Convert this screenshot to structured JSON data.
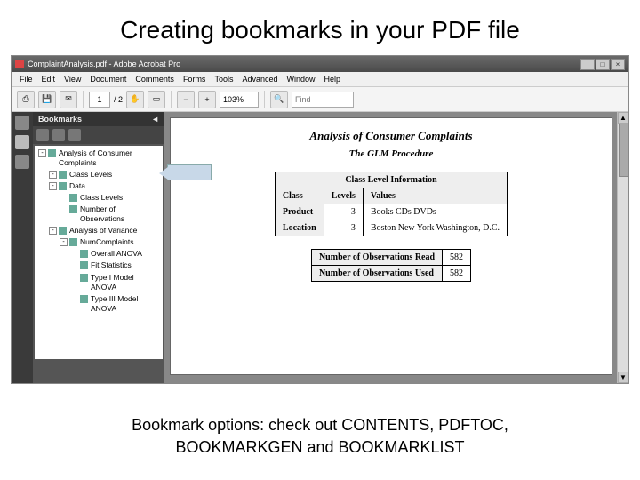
{
  "slide": {
    "title": "Creating bookmarks in your PDF file",
    "footer_line1": "Bookmark options: check out CONTENTS, PDFTOC,",
    "footer_line2": "BOOKMARKGEN and BOOKMARKLIST"
  },
  "window": {
    "title": "ComplaintAnalysis.pdf - Adobe Acrobat Pro",
    "controls": {
      "min": "_",
      "max": "□",
      "close": "×"
    }
  },
  "menu": [
    "File",
    "Edit",
    "View",
    "Document",
    "Comments",
    "Forms",
    "Tools",
    "Advanced",
    "Window",
    "Help"
  ],
  "toolbar": {
    "page_current": "1",
    "page_total": "/ 2",
    "zoom": "103%",
    "find_placeholder": "Find"
  },
  "panel": {
    "header": "Bookmarks",
    "tree": [
      {
        "level": 0,
        "toggle": "-",
        "label": "Analysis of Consumer Complaints"
      },
      {
        "level": 1,
        "toggle": "-",
        "label": "Class Levels"
      },
      {
        "level": 1,
        "toggle": "-",
        "label": "Data"
      },
      {
        "level": 2,
        "toggle": "",
        "label": "Class Levels"
      },
      {
        "level": 2,
        "toggle": "",
        "label": "Number of Observations"
      },
      {
        "level": 1,
        "toggle": "-",
        "label": "Analysis of Variance"
      },
      {
        "level": 2,
        "toggle": "-",
        "label": "NumComplaints"
      },
      {
        "level": 3,
        "toggle": "",
        "label": "Overall ANOVA"
      },
      {
        "level": 3,
        "toggle": "",
        "label": "Fit Statistics"
      },
      {
        "level": 3,
        "toggle": "",
        "label": "Type I Model ANOVA"
      },
      {
        "level": 3,
        "toggle": "",
        "label": "Type III Model ANOVA"
      }
    ]
  },
  "doc": {
    "title": "Analysis of Consumer Complaints",
    "subtitle": "The GLM Procedure",
    "class_caption": "Class Level Information",
    "class_headers": [
      "Class",
      "Levels",
      "Values"
    ],
    "class_rows": [
      [
        "Product",
        "3",
        "Books CDs DVDs"
      ],
      [
        "Location",
        "3",
        "Boston New York Washington, D.C."
      ]
    ],
    "obs_rows": [
      [
        "Number of Observations Read",
        "582"
      ],
      [
        "Number of Observations Used",
        "582"
      ]
    ]
  }
}
